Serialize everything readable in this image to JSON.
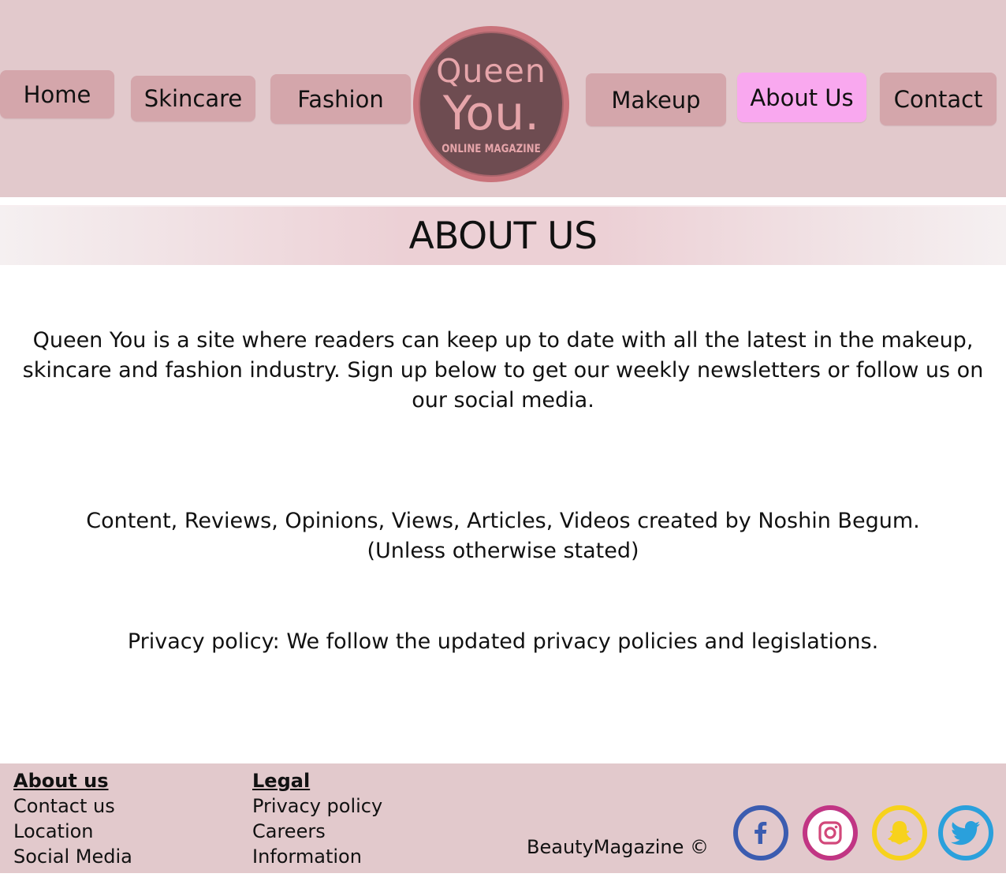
{
  "nav": {
    "items": [
      {
        "label": "Home"
      },
      {
        "label": "Skincare"
      },
      {
        "label": "Fashion"
      },
      {
        "label": "Makeup"
      },
      {
        "label": "About Us"
      },
      {
        "label": "Contact"
      }
    ],
    "active": "About Us"
  },
  "logo": {
    "line1": "Queen",
    "line2": "You.",
    "line3": "ONLINE MAGAZINE"
  },
  "page_title": "ABOUT US",
  "content": {
    "intro": "Queen You is a site where readers can keep up to date with all the latest in the makeup, skincare and fashion industry. Sign up below to get our weekly newsletters or follow us on our social media.",
    "credits_line1": "Content, Reviews, Opinions, Views, Articles, Videos created by Noshin Begum.",
    "credits_line2": "(Unless otherwise stated)",
    "privacy": "Privacy policy: We follow the updated privacy policies and legislations."
  },
  "footer": {
    "about": {
      "heading": "About us",
      "links": [
        "Contact us",
        "Location",
        "Social Media"
      ]
    },
    "legal": {
      "heading": "Legal",
      "links": [
        "Privacy policy",
        "Careers",
        "Information"
      ]
    },
    "copyright": "BeautyMagazine ©"
  },
  "social": [
    {
      "icon": "facebook-icon",
      "color": "#3b5cb0"
    },
    {
      "icon": "instagram-icon",
      "color": "#c13584"
    },
    {
      "icon": "snapchat-icon",
      "color": "#f7d21c"
    },
    {
      "icon": "twitter-icon",
      "color": "#2aa0dc"
    }
  ],
  "colors": {
    "header_bg": "#e2c9cc",
    "nav_button": "#d4a6ab",
    "nav_active": "#f9a8ef",
    "logo_bg": "#6e4c51",
    "logo_text": "#e6a5aa"
  }
}
